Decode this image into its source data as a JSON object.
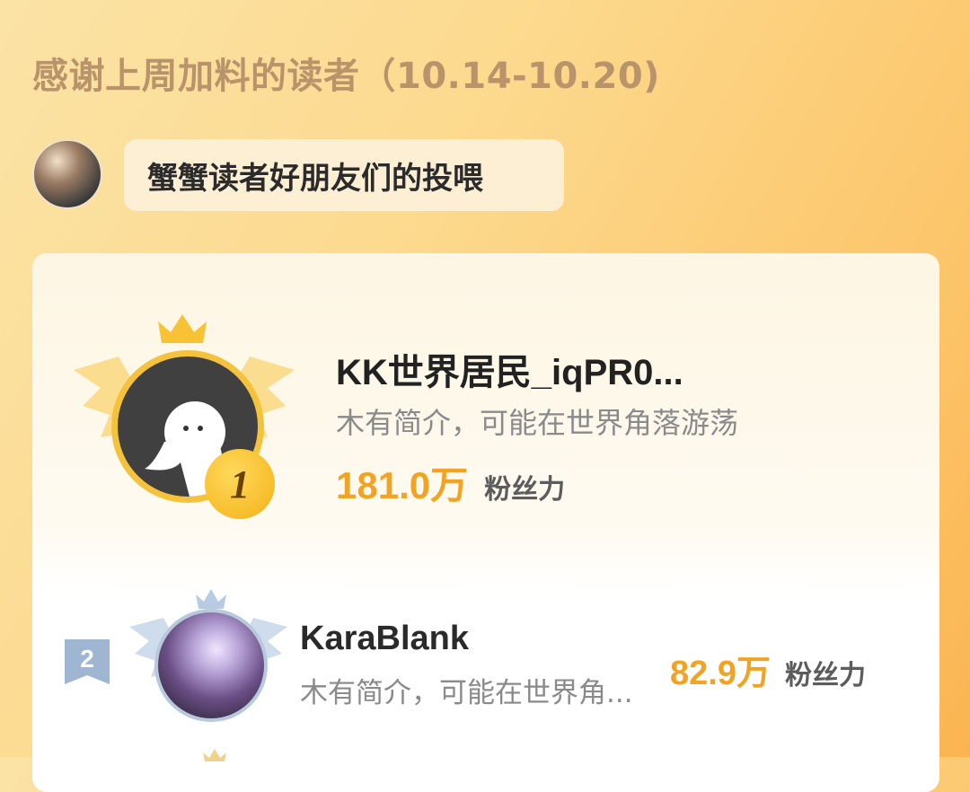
{
  "header": {
    "title": "感谢上周加料的读者（10.14-10.20)"
  },
  "host": {
    "message": "蟹蟹读者好朋友们的投喂"
  },
  "ranking": [
    {
      "rank": "1",
      "name": "KK世界居民_iqPR0...",
      "bio": "木有简介，可能在世界角落游荡",
      "fans_value": "181.0万",
      "fans_label": "粉丝力"
    },
    {
      "rank": "2",
      "name": "KaraBlank",
      "bio": "木有简介，可能在世界角...",
      "fans_value": "82.9万",
      "fans_label": "粉丝力"
    }
  ],
  "colors": {
    "accent": "#f2a323",
    "gold": "#f4c23c",
    "silver": "#b8c9dc"
  }
}
